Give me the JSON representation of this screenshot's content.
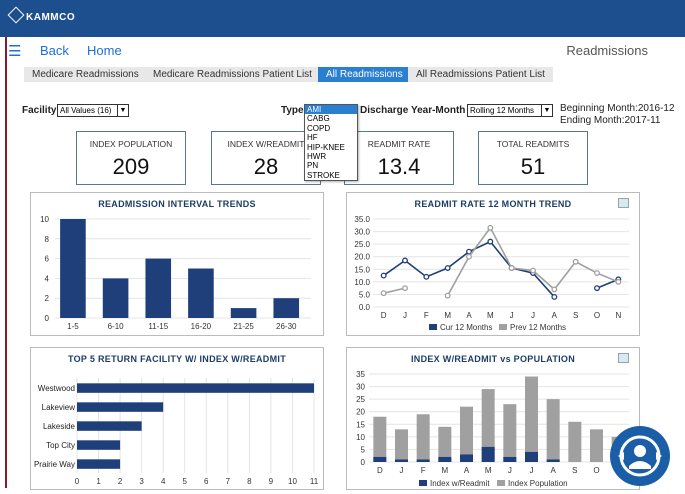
{
  "app": {
    "logo": "KAMMCO"
  },
  "nav": {
    "back": "Back",
    "home": "Home",
    "page_title": "Readmissions"
  },
  "tabs": [
    {
      "label": "Medicare Readmissions"
    },
    {
      "label": "Medicare Readmissions Patient List"
    },
    {
      "label": "All Readmissions"
    },
    {
      "label": "All Readmissions Patient List"
    }
  ],
  "filters": {
    "facility_label": "Facility",
    "facility_value": "All Values (16)",
    "type_label": "Type",
    "type_value": "AMI",
    "discharge_label": "Discharge Year-Month",
    "discharge_value": "Rolling 12 Months",
    "beginning": "Beginning Month:2016-12",
    "ending": "Ending Month:2017-11",
    "type_options": [
      "AMI",
      "CABG",
      "COPD",
      "HF",
      "HIP-KNEE",
      "HWR",
      "PN",
      "STROKE"
    ]
  },
  "kpis": [
    {
      "label": "INDEX POPULATION",
      "value": "209"
    },
    {
      "label": "INDEX W/READMIT",
      "value": "28"
    },
    {
      "label": "READMIT RATE",
      "value": "13.4"
    },
    {
      "label": "TOTAL READMITS",
      "value": "51"
    }
  ],
  "colors": {
    "navy": "#1f3f7a",
    "grey": "#a0a0a0",
    "accent": "#2b7fd0"
  },
  "chart_data": [
    {
      "type": "bar",
      "title": "READMISSION INTERVAL TRENDS",
      "categories": [
        "1-5",
        "6-10",
        "11-15",
        "16-20",
        "21-25",
        "26-30"
      ],
      "values": [
        10,
        4,
        6,
        5,
        1,
        2
      ],
      "ylim": [
        0,
        10
      ],
      "yticks": [
        "10",
        "8",
        "6",
        "4",
        "2",
        "0"
      ]
    },
    {
      "type": "line",
      "title": "READMIT RATE 12 MONTH TREND",
      "x": [
        "D",
        "J",
        "F",
        "M",
        "A",
        "M",
        "J",
        "J",
        "A",
        "S",
        "O",
        "N"
      ],
      "ylim": [
        0,
        35
      ],
      "yticks": [
        "35.0",
        "30.0",
        "25.0",
        "20.0",
        "15.0",
        "10.0",
        "5.0",
        "0.0"
      ],
      "series": [
        {
          "name": "Cur 12 Months",
          "values": [
            12.5,
            18.5,
            12,
            15.5,
            22,
            26,
            15.5,
            13.5,
            4,
            null,
            7.5,
            11
          ]
        },
        {
          "name": "Prev 12 Months",
          "values": [
            5.5,
            7.5,
            null,
            4.5,
            20,
            31.5,
            15.5,
            14.5,
            7,
            18,
            13.5,
            10
          ]
        }
      ]
    },
    {
      "type": "bar",
      "title": "TOP 5 RETURN FACILITY W/ INDEX W/READMIT",
      "categories": [
        "Westwood",
        "Lakeview",
        "Lakeside",
        "Top City",
        "Prairie Way"
      ],
      "values": [
        11,
        4,
        3,
        2,
        2
      ],
      "xlim": [
        0,
        11
      ],
      "xticks": [
        "0",
        "1",
        "2",
        "3",
        "4",
        "5",
        "6",
        "7",
        "8",
        "9",
        "10",
        "11"
      ]
    },
    {
      "type": "bar",
      "title": "INDEX W/READMIT vs POPULATION",
      "categories": [
        "D",
        "J",
        "F",
        "M",
        "A",
        "M",
        "J",
        "J",
        "A",
        "S",
        "O",
        "N"
      ],
      "ylim": [
        0,
        35
      ],
      "yticks": [
        "35",
        "30",
        "25",
        "20",
        "15",
        "10",
        "5",
        "0"
      ],
      "series": [
        {
          "name": "Index w/Readmit",
          "values": [
            2,
            1,
            1,
            2,
            3,
            6,
            2,
            4,
            1,
            0,
            0,
            1
          ]
        },
        {
          "name": "Index Population",
          "values": [
            18,
            13,
            19,
            14,
            22,
            29,
            23,
            34,
            25,
            16,
            13,
            10
          ]
        }
      ]
    }
  ]
}
